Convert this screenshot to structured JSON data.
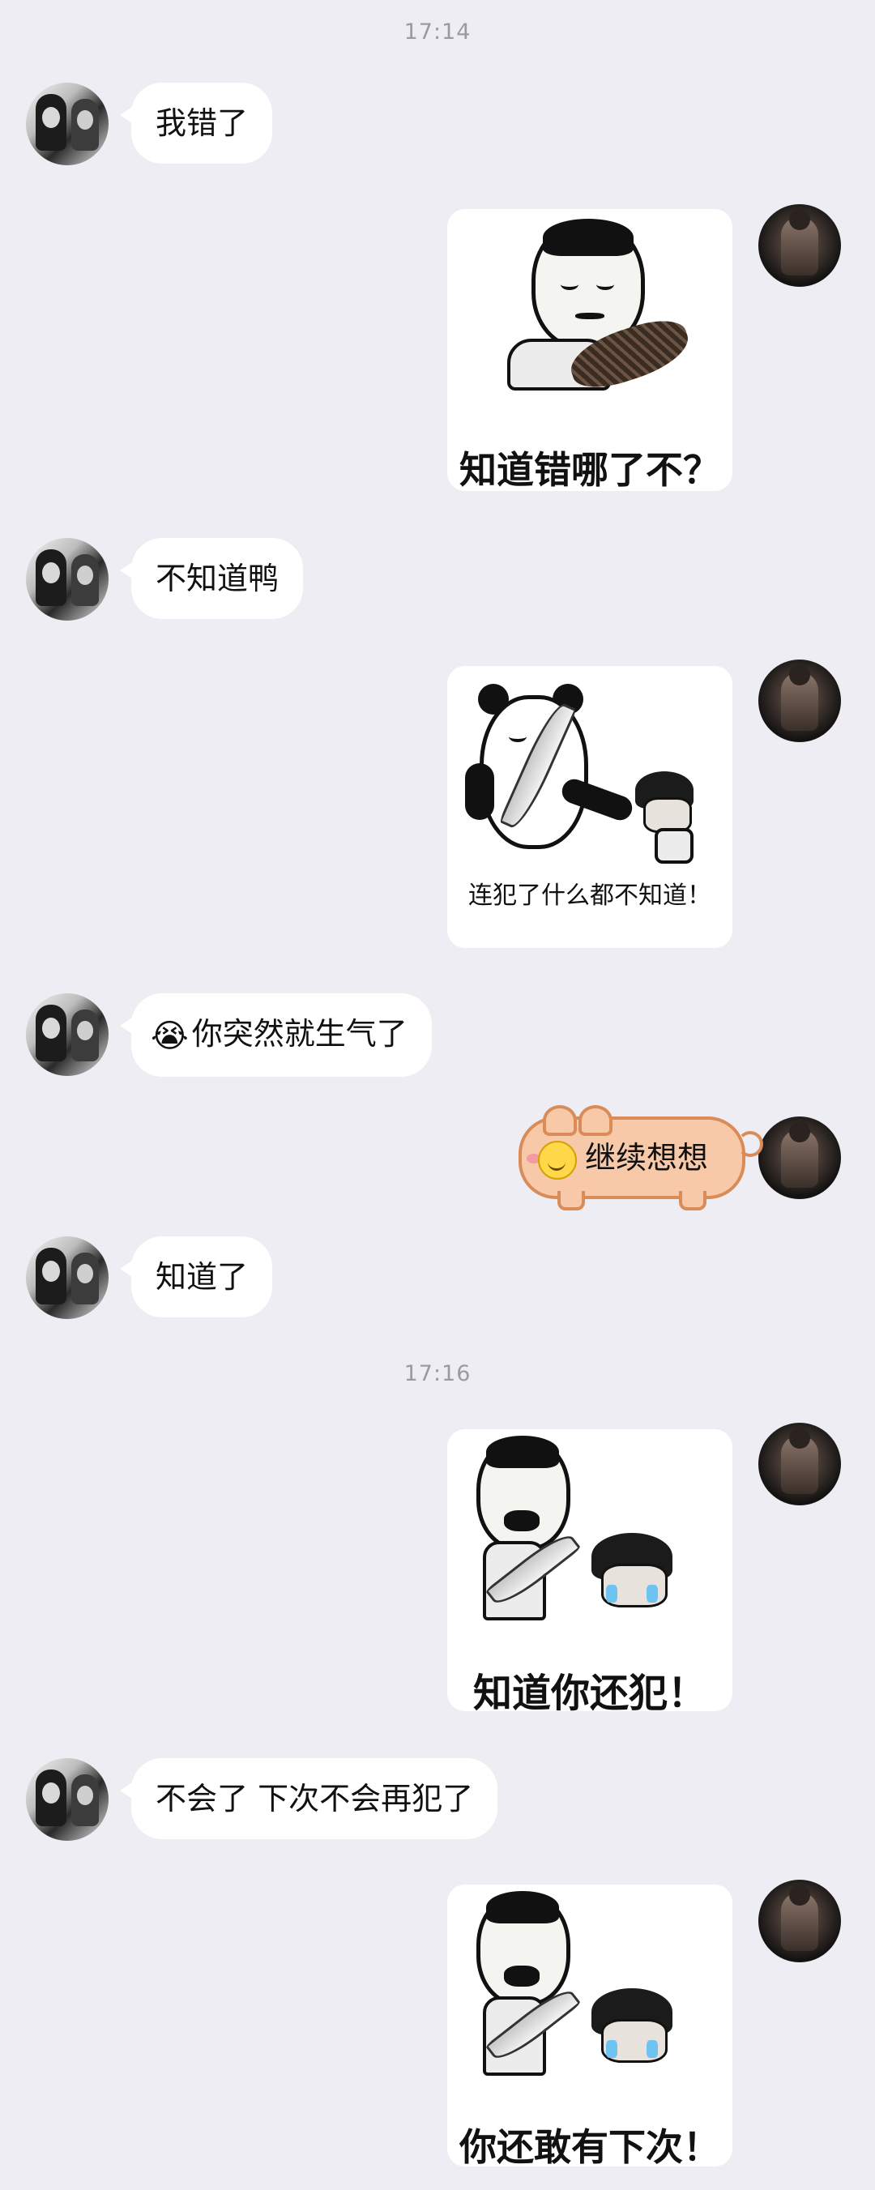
{
  "timestamps": [
    "17:14",
    "17:16"
  ],
  "participants": {
    "left": "avatar-her",
    "right": "avatar-me"
  },
  "messages": [
    {
      "side": "left",
      "text": "我错了"
    },
    {
      "side": "right",
      "type": "sticker",
      "caption": "知道错哪了不？",
      "figure": "man-with-feather-duster"
    },
    {
      "side": "left",
      "text": "不知道鸭"
    },
    {
      "side": "right",
      "type": "sticker",
      "caption": "连犯了什么都不知道！",
      "figure": "panda-with-sword"
    },
    {
      "side": "left",
      "emoji": "😭",
      "text": "你突然就生气了"
    },
    {
      "side": "right",
      "type": "pig-bubble",
      "emoji": "☺",
      "text": "继续想想"
    },
    {
      "side": "left",
      "text": "知道了"
    },
    {
      "side": "right",
      "type": "sticker",
      "caption": "知道你还犯！",
      "figure": "man-with-knife"
    },
    {
      "side": "left",
      "text": "不会了 下次不会再犯了"
    },
    {
      "side": "right",
      "type": "sticker",
      "caption": "你还敢有下次！",
      "figure": "man-with-knife"
    }
  ],
  "colors": {
    "background": "#ededf3",
    "bubble": "#ffffff",
    "pig_fill": "#f7c9a8",
    "pig_border": "#d98c58",
    "timestamp": "#9a9aa2"
  }
}
